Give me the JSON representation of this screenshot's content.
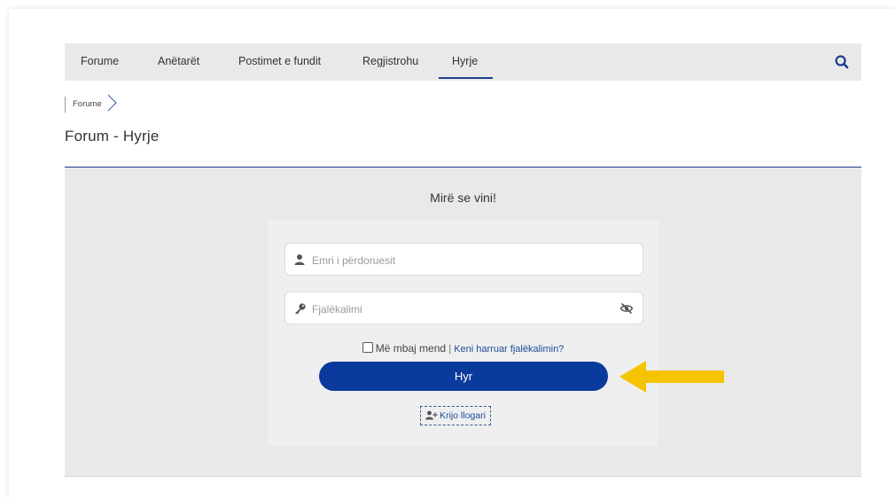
{
  "nav": {
    "items": [
      {
        "label": "Forume"
      },
      {
        "label": "Anëtarët"
      },
      {
        "label": "Postimet e fundit"
      },
      {
        "label": "Regjistrohu"
      },
      {
        "label": "Hyrje",
        "active": true
      }
    ],
    "search_icon": "search-icon"
  },
  "breadcrumb": {
    "items": [
      "Forume"
    ]
  },
  "page": {
    "title": "Forum - Hyrje"
  },
  "login": {
    "welcome": "Mirë se vini!",
    "username_placeholder": "Emri i përdoruesit",
    "password_placeholder": "Fjalëkalimi",
    "remember_label": "Më mbaj mend",
    "separator": "|",
    "forgot_link": "Keni harruar fjalëkalimin?",
    "submit_label": "Hyr",
    "create_account_label": "Krijo llogari"
  },
  "colors": {
    "accent": "#0a3a9c",
    "nav_bg": "#e9e9e9",
    "arrow": "#f5c400"
  }
}
